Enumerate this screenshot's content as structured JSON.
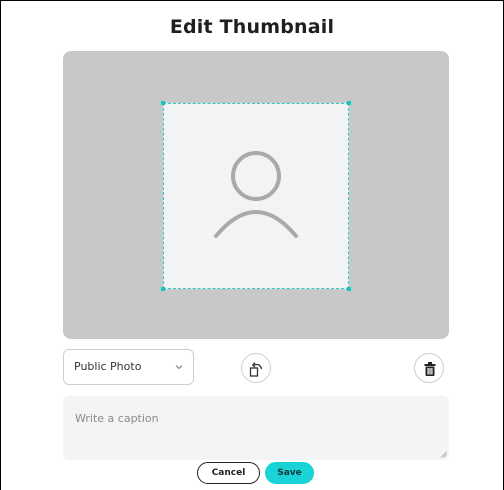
{
  "dialog": {
    "title": "Edit Thumbnail"
  },
  "editor": {
    "placeholder_icon": "user-avatar-icon",
    "accent_color": "#19d3d6"
  },
  "controls": {
    "privacy_select": {
      "value": "Public Photo",
      "icon": "chevron-down-icon"
    },
    "rotate_icon": "rotate-icon",
    "delete_icon": "trash-icon"
  },
  "caption": {
    "placeholder": "Write a caption",
    "value": ""
  },
  "actions": {
    "cancel_label": "Cancel",
    "save_label": "Save"
  }
}
